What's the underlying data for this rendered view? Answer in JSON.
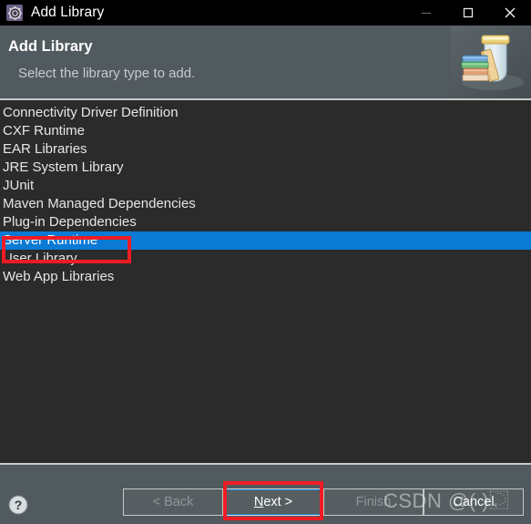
{
  "window": {
    "title": "Add Library",
    "icon": "library-gear-icon",
    "controls": {
      "minimize": "minimize-icon",
      "maximize": "maximize-icon",
      "close": "close-icon"
    }
  },
  "header": {
    "title": "Add Library",
    "subtitle": "Select the library type to add.",
    "art": "book-jar-illustration"
  },
  "list": {
    "items": [
      {
        "label": "Connectivity Driver Definition",
        "selected": false
      },
      {
        "label": "CXF Runtime",
        "selected": false
      },
      {
        "label": "EAR Libraries",
        "selected": false
      },
      {
        "label": "JRE System Library",
        "selected": false
      },
      {
        "label": "JUnit",
        "selected": false
      },
      {
        "label": "Maven Managed Dependencies",
        "selected": false
      },
      {
        "label": "Plug-in Dependencies",
        "selected": false
      },
      {
        "label": "Server Runtime",
        "selected": true
      },
      {
        "label": "User Library",
        "selected": false
      },
      {
        "label": "Web App Libraries",
        "selected": false
      }
    ]
  },
  "footer": {
    "help_icon": "help-question-icon",
    "buttons": [
      {
        "name": "back",
        "label": "< Back",
        "mnemonic": "",
        "disabled": true,
        "focused": false
      },
      {
        "name": "next",
        "label": "Next >",
        "mnemonic": "N",
        "disabled": false,
        "focused": true
      },
      {
        "name": "finish",
        "label": "Finish",
        "mnemonic": "",
        "disabled": true,
        "focused": false
      },
      {
        "name": "cancel",
        "label": "Cancel",
        "mnemonic": "",
        "disabled": false,
        "focused": false
      }
    ]
  },
  "annotations": {
    "highlight_list_item": "Server Runtime",
    "highlight_button": "Next >",
    "color": "#ee1c25"
  },
  "watermark": {
    "text": "CSDN @(          )⿿"
  },
  "colors": {
    "titlebar_bg": "#000000",
    "header_bg": "#515a5e",
    "list_bg": "#2b2b2b",
    "selection_blue": "#0a7ad4",
    "annotation_red": "#ee1c25",
    "focus_blue": "#1f7fd4"
  }
}
